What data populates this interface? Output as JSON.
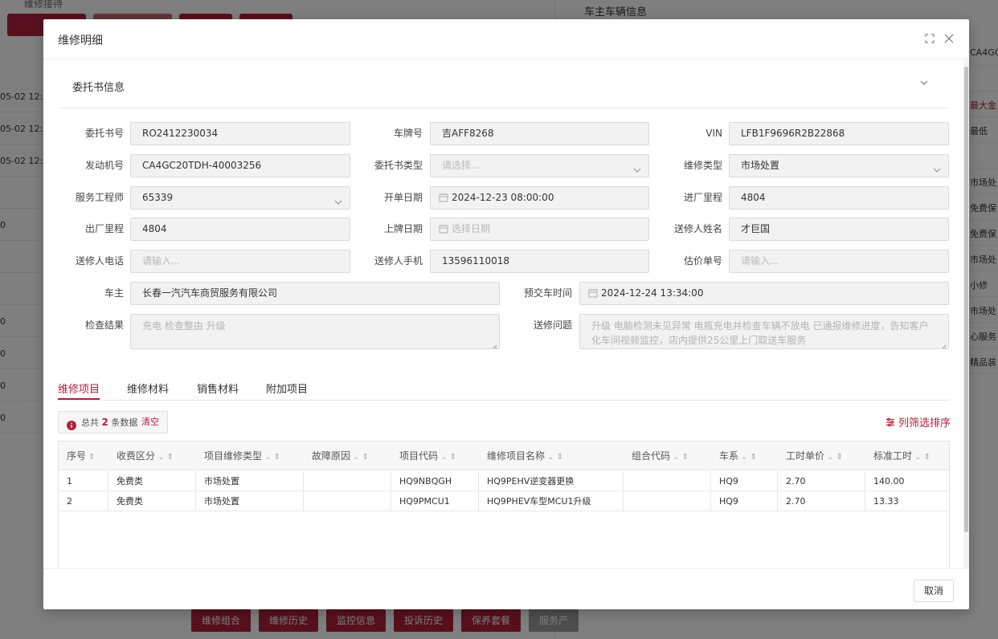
{
  "background": {
    "breadcrumb": "维修接待",
    "right_panel_title": "车主车辆信息",
    "left_rows": [
      "05-02 12:5",
      "05-02 12:5",
      "05-02 12:5",
      "",
      "0",
      "",
      "",
      "0",
      "0",
      "0",
      "0"
    ],
    "right_column": [
      "CA4GC",
      "",
      "最大金",
      "最低",
      "",
      "市场处",
      "免费保",
      "免费保",
      "市场处",
      "小修",
      "市场处",
      "心服务",
      "精品装"
    ],
    "bottom_buttons": [
      "维修组合",
      "维修历史",
      "监控信息",
      "投诉历史",
      "保养套餐",
      "服务产"
    ]
  },
  "modal": {
    "title": "维修明细",
    "section_title": "委托书信息",
    "cancel_label": "取消"
  },
  "form": {
    "order_no": {
      "label": "委托书号",
      "value": "RO2412230034"
    },
    "plate": {
      "label": "车牌号",
      "value": "吉AFF8268"
    },
    "vin": {
      "label": "VIN",
      "value": "LFB1F9696R2B22868"
    },
    "engine_no": {
      "label": "发动机号",
      "value": "CA4GC20TDH-40003256"
    },
    "order_type": {
      "label": "委托书类型",
      "placeholder": "请选择..."
    },
    "repair_type": {
      "label": "维修类型",
      "value": "市场处置"
    },
    "engineer": {
      "label": "服务工程师",
      "value": "65339"
    },
    "open_date": {
      "label": "开单日期",
      "value": "2024-12-23 08:00:00"
    },
    "mileage_in": {
      "label": "进厂里程",
      "value": "4804"
    },
    "mileage_out": {
      "label": "出厂里程",
      "value": "4804"
    },
    "plate_date": {
      "label": "上牌日期",
      "placeholder": "选择日期"
    },
    "sender_name": {
      "label": "送修人姓名",
      "value": "才巨国"
    },
    "sender_phone": {
      "label": "送修人电话",
      "placeholder": "请输入..."
    },
    "sender_mobile": {
      "label": "送修人手机",
      "value": "13596110018"
    },
    "estimate_no": {
      "label": "估价单号",
      "placeholder": "请输入..."
    },
    "owner": {
      "label": "车主",
      "value": "长春一汽汽车商贸服务有限公司"
    },
    "delivery_time": {
      "label": "预交车时间",
      "value": "2024-12-24 13:34:00"
    },
    "check_result": {
      "label": "检查结果",
      "value": "充电 检查整由 升级"
    },
    "repair_issue": {
      "label": "送修问题",
      "value": "升级 电脑检测未见异常 电瓶充电并检查车辆不放电 已通报维修进度，告知客户化车间视频监控，店内提供25公里上门取送车服务"
    }
  },
  "tabs": [
    {
      "label": "维修项目",
      "active": true
    },
    {
      "label": "维修材料",
      "active": false
    },
    {
      "label": "销售材料",
      "active": false
    },
    {
      "label": "附加项目",
      "active": false
    }
  ],
  "summary": {
    "prefix": "总共",
    "count": "2",
    "suffix": "条数据",
    "clear_label": "清空"
  },
  "column_sort_label": "列筛选排序",
  "table": {
    "columns": [
      "序号",
      "收费区分",
      "项目维修类型",
      "故障原因",
      "项目代码",
      "维修项目名称",
      "组合代码",
      "车系",
      "工时单价",
      "标准工时"
    ],
    "rows": [
      [
        "1",
        "免费类",
        "市场处置",
        "",
        "HQ9NBQGH",
        "HQ9PEHV逆变器更换",
        "",
        "HQ9",
        "2.70",
        "140.00"
      ],
      [
        "2",
        "免费类",
        "市场处置",
        "",
        "HQ9PMCU1",
        "HQ9PHEV车型MCU1升级",
        "",
        "HQ9",
        "2.70",
        "13.33"
      ]
    ]
  },
  "colors": {
    "accent": "#b0203c",
    "input_bg": "#f2f2f3"
  },
  "icons": [
    "fullscreen-icon",
    "close-icon",
    "chevron-down-icon",
    "calendar-icon",
    "info-icon",
    "filter-icon"
  ]
}
